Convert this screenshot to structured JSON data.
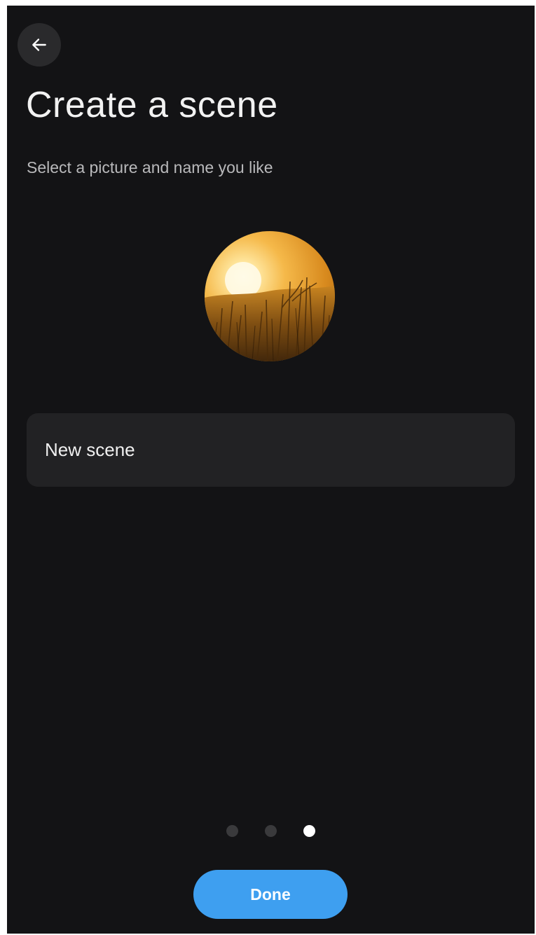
{
  "header": {
    "back_icon": "arrow-left-icon",
    "title": "Create a scene",
    "subtitle": "Select a picture and name you like"
  },
  "scene": {
    "picture_icon": "sunset-field-picture",
    "name_value": "New scene"
  },
  "pager": {
    "total": 3,
    "active_index": 2
  },
  "actions": {
    "done_label": "Done"
  },
  "colors": {
    "background": "#131315",
    "field": "#222224",
    "accent": "#3e9ff0",
    "dot_inactive": "#3a3a3c",
    "dot_active": "#ffffff"
  }
}
